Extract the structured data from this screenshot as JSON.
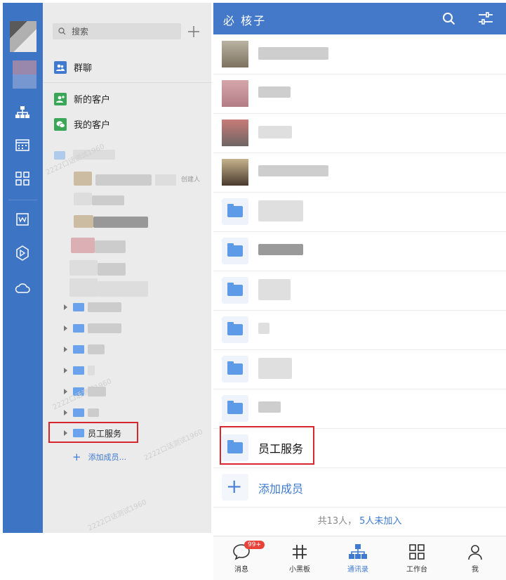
{
  "sidebar": {
    "search_placeholder": "搜索",
    "group_chat": "群聊",
    "new_customers": "新的客户",
    "my_customers": "我的客户",
    "creator_tag": "创建人",
    "staff_service": "员工服务",
    "add_member": "添加成员...",
    "watermark": "2222口话测试1960"
  },
  "header": {
    "title": "必 核子"
  },
  "contacts": {
    "staff_service": "员工服务",
    "add_member": "添加成员",
    "summary_total": "共13人，",
    "summary_unjoined": "5人未加入"
  },
  "tabs": [
    {
      "label": "消息",
      "badge": "99+"
    },
    {
      "label": "小黑板"
    },
    {
      "label": "通讯录"
    },
    {
      "label": "工作台"
    },
    {
      "label": "我"
    }
  ],
  "colors": {
    "brand": "#3e74c4",
    "header": "#4479c9",
    "link": "#3f7ad0",
    "highlight": "#d8262f"
  }
}
